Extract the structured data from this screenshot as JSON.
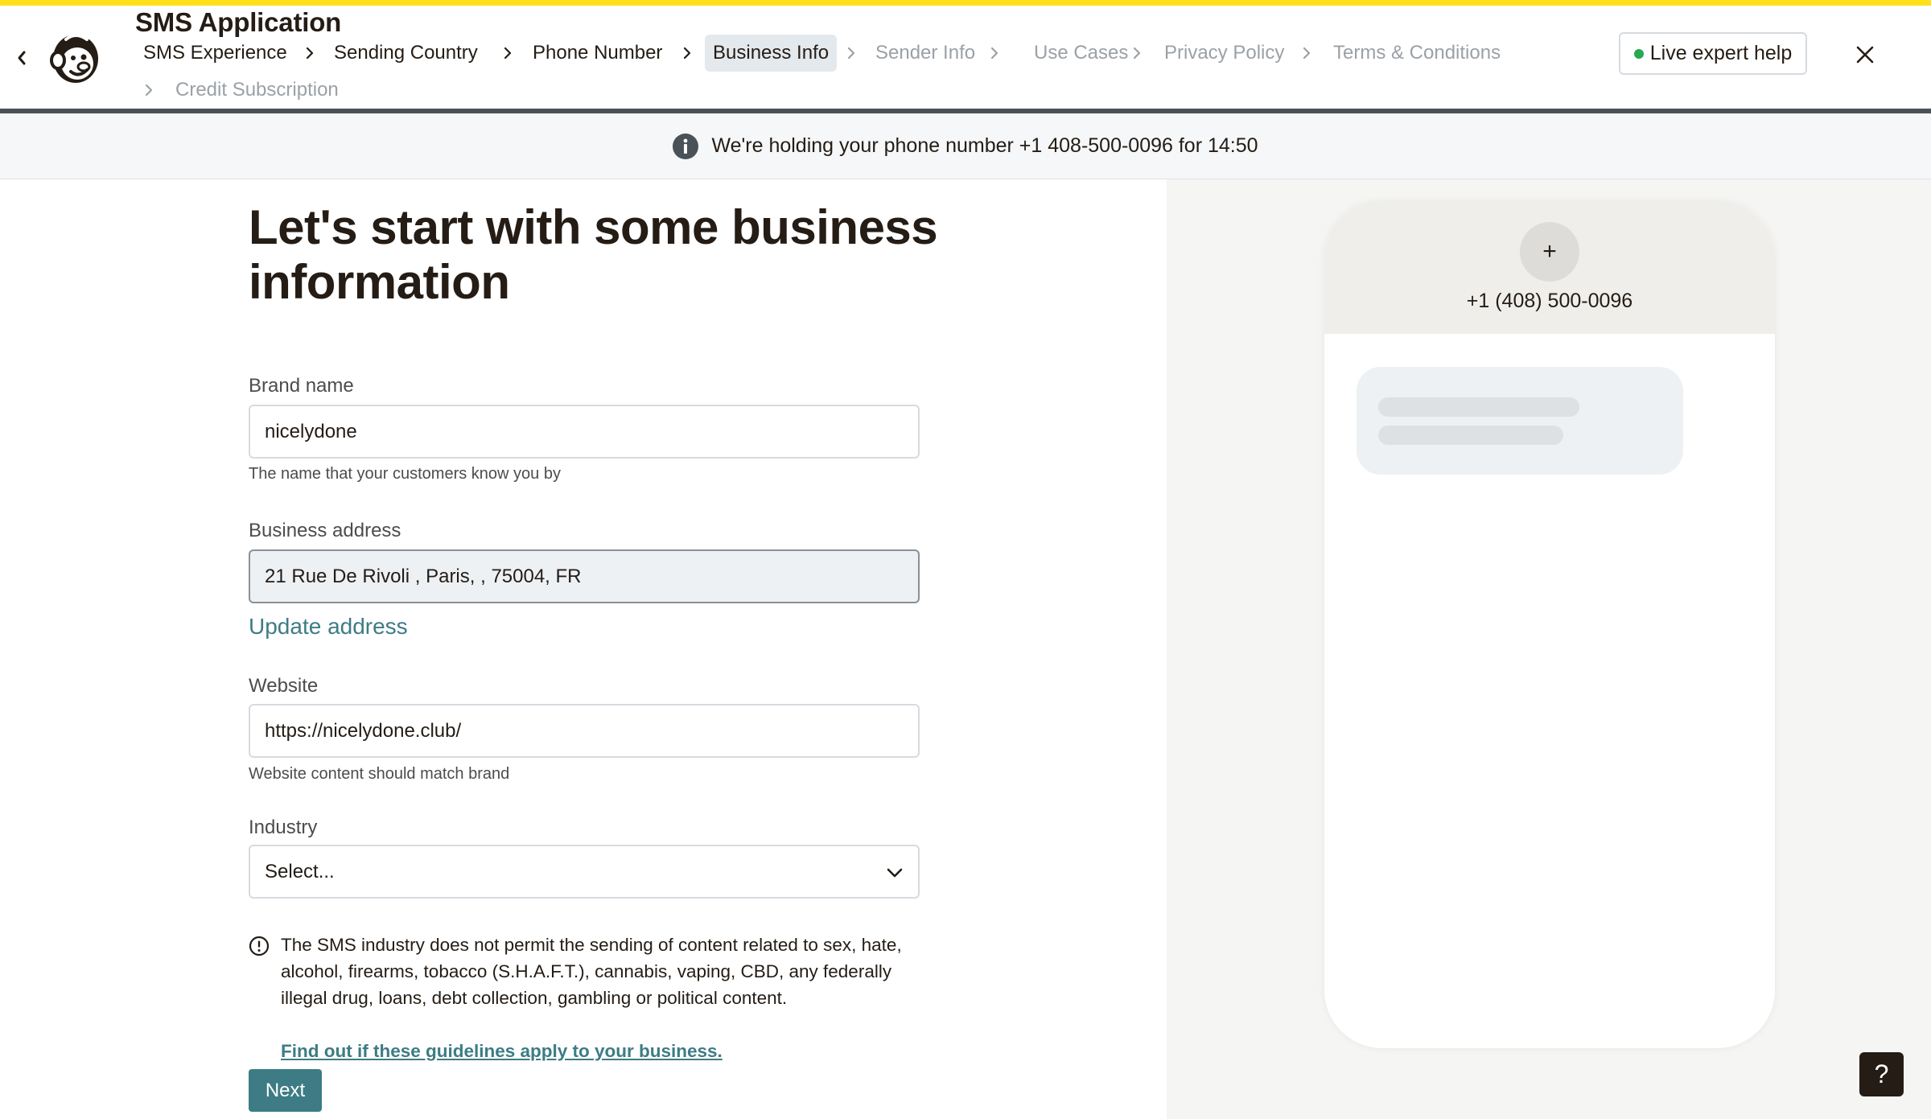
{
  "app": {
    "title": "SMS Application"
  },
  "steps": [
    {
      "label": "SMS Experience",
      "state": "done"
    },
    {
      "label": "Sending Country",
      "state": "done"
    },
    {
      "label": "Phone Number",
      "state": "done"
    },
    {
      "label": "Business Info",
      "state": "active"
    },
    {
      "label": "Sender Info",
      "state": "todo"
    },
    {
      "label": "Use Cases",
      "state": "todo"
    },
    {
      "label": "Privacy Policy",
      "state": "todo"
    },
    {
      "label": "Terms & Conditions",
      "state": "todo"
    },
    {
      "label": "Credit Subscription",
      "state": "todo"
    }
  ],
  "header": {
    "live_help_label": "Live expert help"
  },
  "banner": {
    "text": "We're holding your phone number +1 408-500-0096 for 14:50"
  },
  "form": {
    "heading": "Let's start with some business information",
    "brand": {
      "label": "Brand name",
      "value": "nicelydone",
      "helper": "The name that your customers know you by"
    },
    "address": {
      "label": "Business address",
      "value": "21 Rue De Rivoli , Paris, , 75004, FR",
      "update_label": "Update address"
    },
    "website": {
      "label": "Website",
      "value": "https://nicelydone.club/",
      "helper": "Website content should match brand"
    },
    "industry": {
      "label": "Industry",
      "selected": "Select..."
    },
    "notice": {
      "text": "The SMS industry does not permit the sending of content related to sex, hate, alcohol, firearms, tobacco (S.H.A.F.T.), cannabis, vaping, CBD, any federally illegal drug, loans, debt collection, gambling or political content.",
      "link": "Find out if these guidelines apply to your business."
    },
    "next_label": "Next"
  },
  "preview": {
    "avatar_symbol": "+",
    "phone_number": "+1 (408) 500-0096"
  },
  "help_fab": {
    "symbol": "?"
  },
  "colors": {
    "accent": "#3d7c84",
    "brand_yellow": "#ffe01b",
    "status_online": "#25a954"
  }
}
